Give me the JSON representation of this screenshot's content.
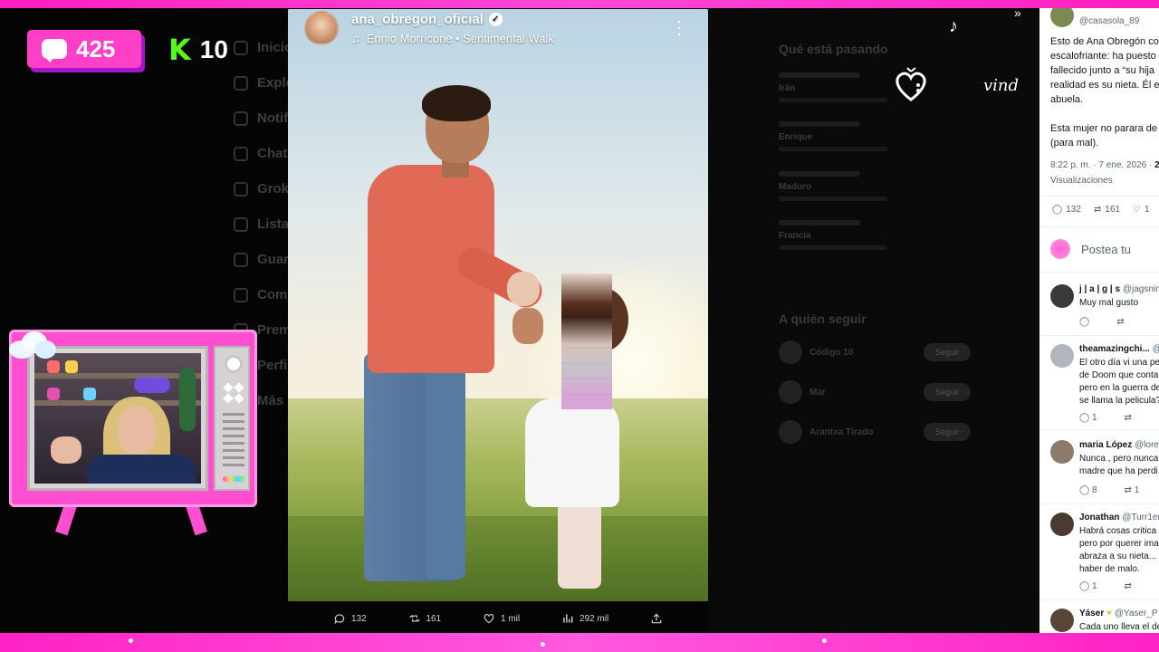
{
  "overlay": {
    "chat_count": "425",
    "kick_letter": "K",
    "kick_count": "10",
    "accent_pink": "#ff3fc8",
    "kick_green": "#53fc18"
  },
  "post": {
    "username": "ana_obregon_oficial",
    "music": "Ennio Morricone • Sentimental Walk",
    "replies": "132",
    "reposts": "161",
    "likes": "1 mil",
    "views": "292 mil"
  },
  "background": {
    "nav_labels": [
      "Inicio",
      "Explorar",
      "Notificaciones",
      "Chat",
      "Grok",
      "Listas",
      "Guardados",
      "Comunidades",
      "Premium",
      "Perfil",
      "Más"
    ],
    "trends_title": "Qué está pasando",
    "trends": [
      "Irán",
      "Enrique",
      "Maduro",
      "Francia"
    ],
    "follow_title": "A quién seguir",
    "follow": [
      "Código 10",
      "Mar",
      "Arantxa Tirado"
    ],
    "follow_button": "Seguir"
  },
  "tweet": {
    "handle": "@casasola_89",
    "text": "Esto de Ana Obregón co\nescalofriante: ha puesto\nfallecido junto a “su hija\nrealidad es su nieta. Él e\nabuela.\n\nEsta mujer no parara de\n(para mal).",
    "meta_time": "8:22 p. m. · 7 ene. 2026 · ",
    "meta_bold": "2",
    "views_label": "Visualizaciones",
    "replies": "132",
    "reposts": "161",
    "likes": "1",
    "compose_placeholder": "Postea tu",
    "comments": [
      {
        "name": "j | a | g | s",
        "handle": "@jagsnine",
        "text": "Muy mal gusto",
        "replies": "",
        "reposts": ""
      },
      {
        "name": "theamazingchi...",
        "handle": "@",
        "text": "El otro día vi una pe\nde Doom que conta\npero en la guerra de\nse llama la pelicula?",
        "replies": "1",
        "reposts": ""
      },
      {
        "name": "maria López",
        "handle": "@lore",
        "text": "Nunca , pero nunca\nmadre que ha perdi",
        "replies": "8",
        "reposts": "1"
      },
      {
        "name": "Jonathan",
        "handle": "@Turr1en",
        "text": "Habrá cosas critica\npero por querer ima\nabraza a su nieta...\nhaber de malo.",
        "replies": "1",
        "reposts": ""
      },
      {
        "name": "Yáser",
        "handle": "@Yaser_P",
        "text": "Cada uno lleva el de",
        "replies": "",
        "reposts": ""
      }
    ]
  },
  "deco": {
    "script_text": "vind"
  }
}
